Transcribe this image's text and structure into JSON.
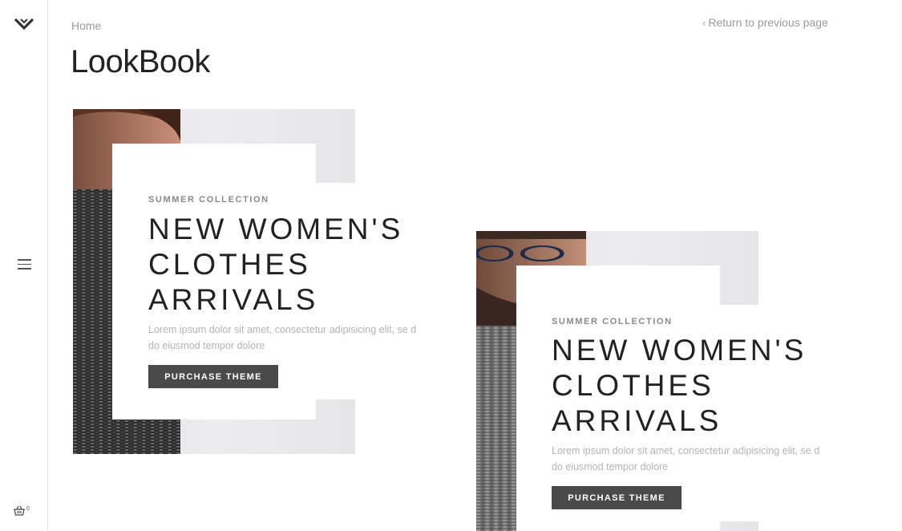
{
  "sidebar": {
    "logo_icon": "chevron-logo-icon",
    "menu_icon": "hamburger-menu-icon",
    "cart_icon": "basket-icon",
    "cart_count": "0"
  },
  "header": {
    "breadcrumb": "Home",
    "title": "LookBook",
    "return_link": "Return to previous page",
    "return_icon": "chevron-left-icon"
  },
  "cards": [
    {
      "eyebrow": "SUMMER COLLECTION",
      "headline_lines": [
        "NEW WOMEN'S",
        "CLOTHES",
        "ARRIVALS"
      ],
      "description": "Lorem ipsum dolor sit amet, consectetur adipisicing elit, se d do eiusmod tempor dolore",
      "button": "PURCHASE THEME"
    },
    {
      "eyebrow": "SUMMER COLLECTION",
      "headline_lines": [
        "NEW WOMEN'S",
        "CLOTHES",
        "ARRIVALS"
      ],
      "description": "Lorem ipsum dolor sit amet, consectetur adipisicing elit, se d do eiusmod tempor dolore",
      "button": "PURCHASE THEME"
    }
  ],
  "colors": {
    "button_bg": "#4a4a4a",
    "muted_text": "#999999",
    "photo_bg": "#e5e5e7"
  }
}
